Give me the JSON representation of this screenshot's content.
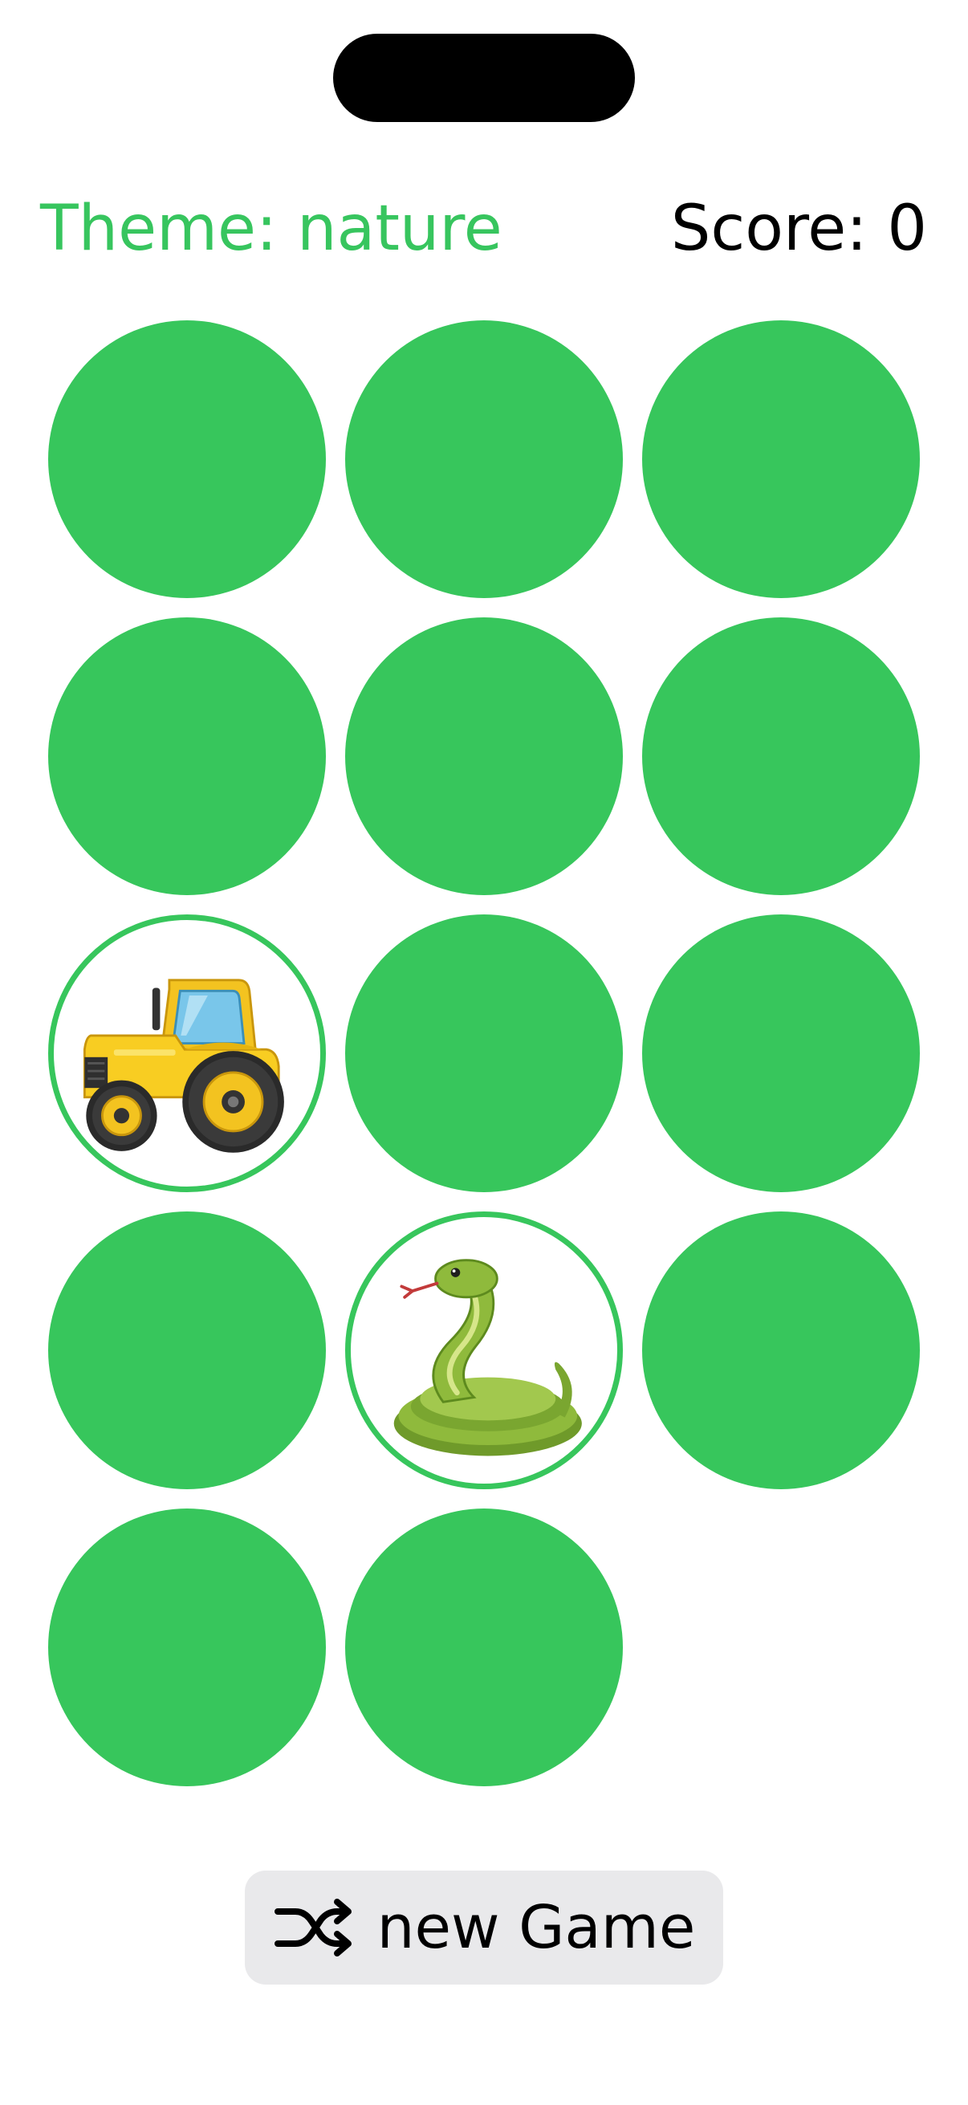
{
  "header": {
    "theme_title": "Theme: nature",
    "score_text": "Score: 0"
  },
  "theme_color": "#37c65c",
  "cards": [
    {
      "state": "face-down"
    },
    {
      "state": "face-down"
    },
    {
      "state": "face-down"
    },
    {
      "state": "face-down"
    },
    {
      "state": "face-down"
    },
    {
      "state": "face-down"
    },
    {
      "state": "face-up",
      "content": "tractor-icon"
    },
    {
      "state": "face-down"
    },
    {
      "state": "face-down"
    },
    {
      "state": "face-down"
    },
    {
      "state": "face-up",
      "content": "snake-icon"
    },
    {
      "state": "face-down"
    },
    {
      "state": "face-down"
    },
    {
      "state": "face-down"
    }
  ],
  "new_game_button": {
    "label": "new Game",
    "icon": "shuffle-icon"
  }
}
